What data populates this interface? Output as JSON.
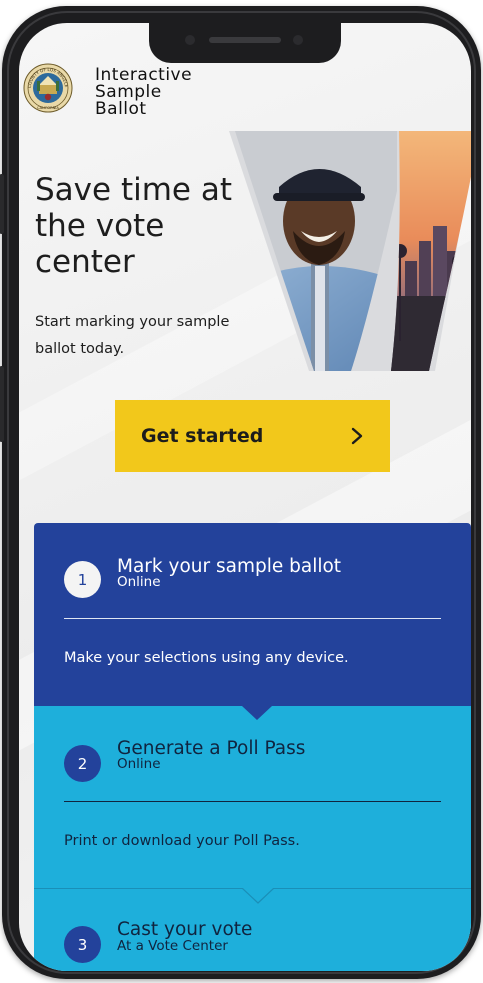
{
  "header": {
    "seal_text": "COUNTY OF LOS ANGELES",
    "seal_bottom": "CALIFORNIA",
    "brand_lines": [
      "Interactive",
      "Sample",
      "Ballot"
    ]
  },
  "intro": {
    "headline": "Save time at the vote center",
    "subtext": "Start marking your sample ballot today.",
    "cta_label": "Get started"
  },
  "steps": [
    {
      "number": "1",
      "title": "Mark your sample ballot",
      "subtitle": "Online",
      "description": "Make your selections using any device."
    },
    {
      "number": "2",
      "title": "Generate a Poll Pass",
      "subtitle": "Online",
      "description": "Print or download your Poll Pass."
    },
    {
      "number": "3",
      "title": "Cast your vote",
      "subtitle": "At a Vote Center"
    }
  ],
  "colors": {
    "primary_blue": "#23429b",
    "light_blue": "#1eafdb",
    "cta_yellow": "#f2c81b"
  },
  "icons": {
    "cta": "chevron-right-icon",
    "seal": "county-seal-icon"
  }
}
